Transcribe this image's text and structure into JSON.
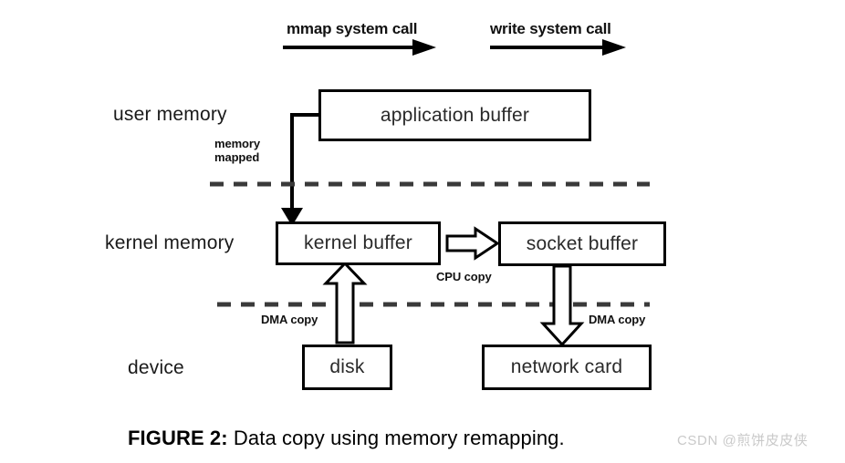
{
  "figure": {
    "caption_prefix": "FIGURE 2:",
    "caption_text": "Data copy using memory remapping."
  },
  "syscalls": [
    {
      "label": "mmap system call"
    },
    {
      "label": "write system call"
    }
  ],
  "rows": [
    {
      "label": "user memory"
    },
    {
      "label": "kernel memory"
    },
    {
      "label": "device"
    }
  ],
  "boxes": [
    {
      "label": "application buffer"
    },
    {
      "label": "kernel buffer"
    },
    {
      "label": "socket buffer"
    },
    {
      "label": "disk"
    },
    {
      "label": "network card"
    }
  ],
  "annotations": {
    "memory_mapped_line1": "memory",
    "memory_mapped_line2": "mapped",
    "cpu_copy": "CPU copy",
    "dma_copy_left": "DMA copy",
    "dma_copy_right": "DMA copy"
  },
  "watermark": {
    "text": "CSDN @煎饼皮皮侠"
  },
  "colors": {
    "stroke": "#000000",
    "background": "#ffffff",
    "dashed_separator": "#3a3a3a",
    "watermark": "#c9c9c9"
  }
}
